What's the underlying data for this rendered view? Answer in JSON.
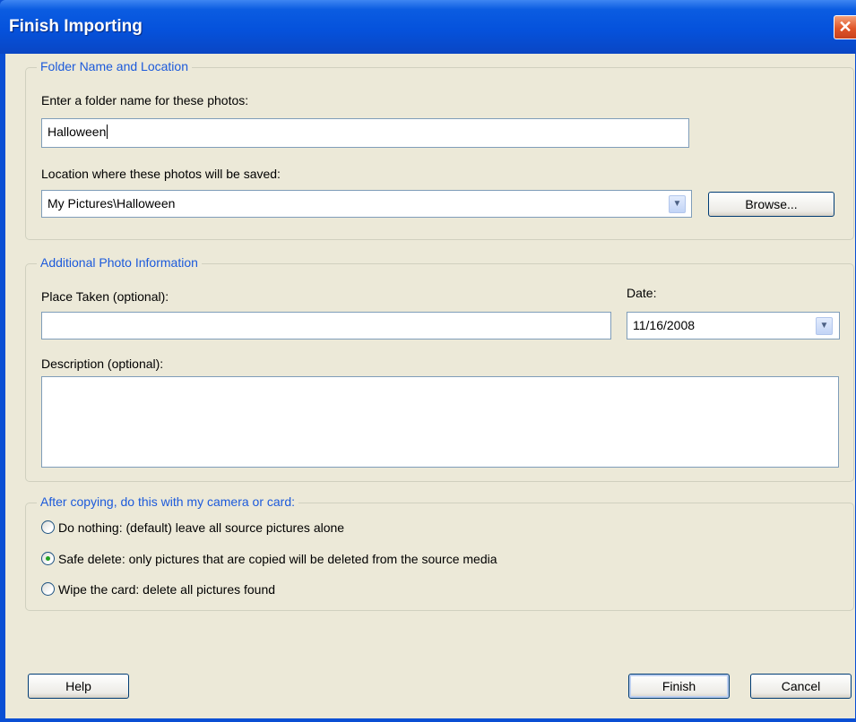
{
  "window": {
    "title": "Finish Importing"
  },
  "folder_group": {
    "legend": "Folder Name and Location",
    "name_label": "Enter a folder name for these photos:",
    "name_value": "Halloween",
    "location_label": "Location where these photos will be saved:",
    "location_value": "My Pictures\\Halloween",
    "browse_label": "Browse..."
  },
  "info_group": {
    "legend": "Additional Photo Information",
    "place_label": "Place Taken (optional):",
    "place_value": "",
    "date_label": "Date:",
    "date_value": "11/16/2008",
    "description_label": "Description (optional):",
    "description_value": ""
  },
  "after_group": {
    "legend": "After copying, do this with my camera or card:",
    "options": [
      {
        "label": "Do nothing: (default) leave all source pictures alone",
        "selected": false
      },
      {
        "label": "Safe delete: only pictures that are copied will be deleted from the source media",
        "selected": true
      },
      {
        "label": "Wipe the card: delete all pictures found",
        "selected": false
      }
    ]
  },
  "buttons": {
    "help": "Help",
    "finish": "Finish",
    "cancel": "Cancel"
  },
  "icons": {
    "close": "close-icon",
    "dropdown": "chevron-down-icon"
  },
  "colors": {
    "titlebar": "#0552dc",
    "legend_text": "#1c5adb",
    "dialog_bg": "#ece9d8",
    "selected_radio": "#21a121"
  }
}
